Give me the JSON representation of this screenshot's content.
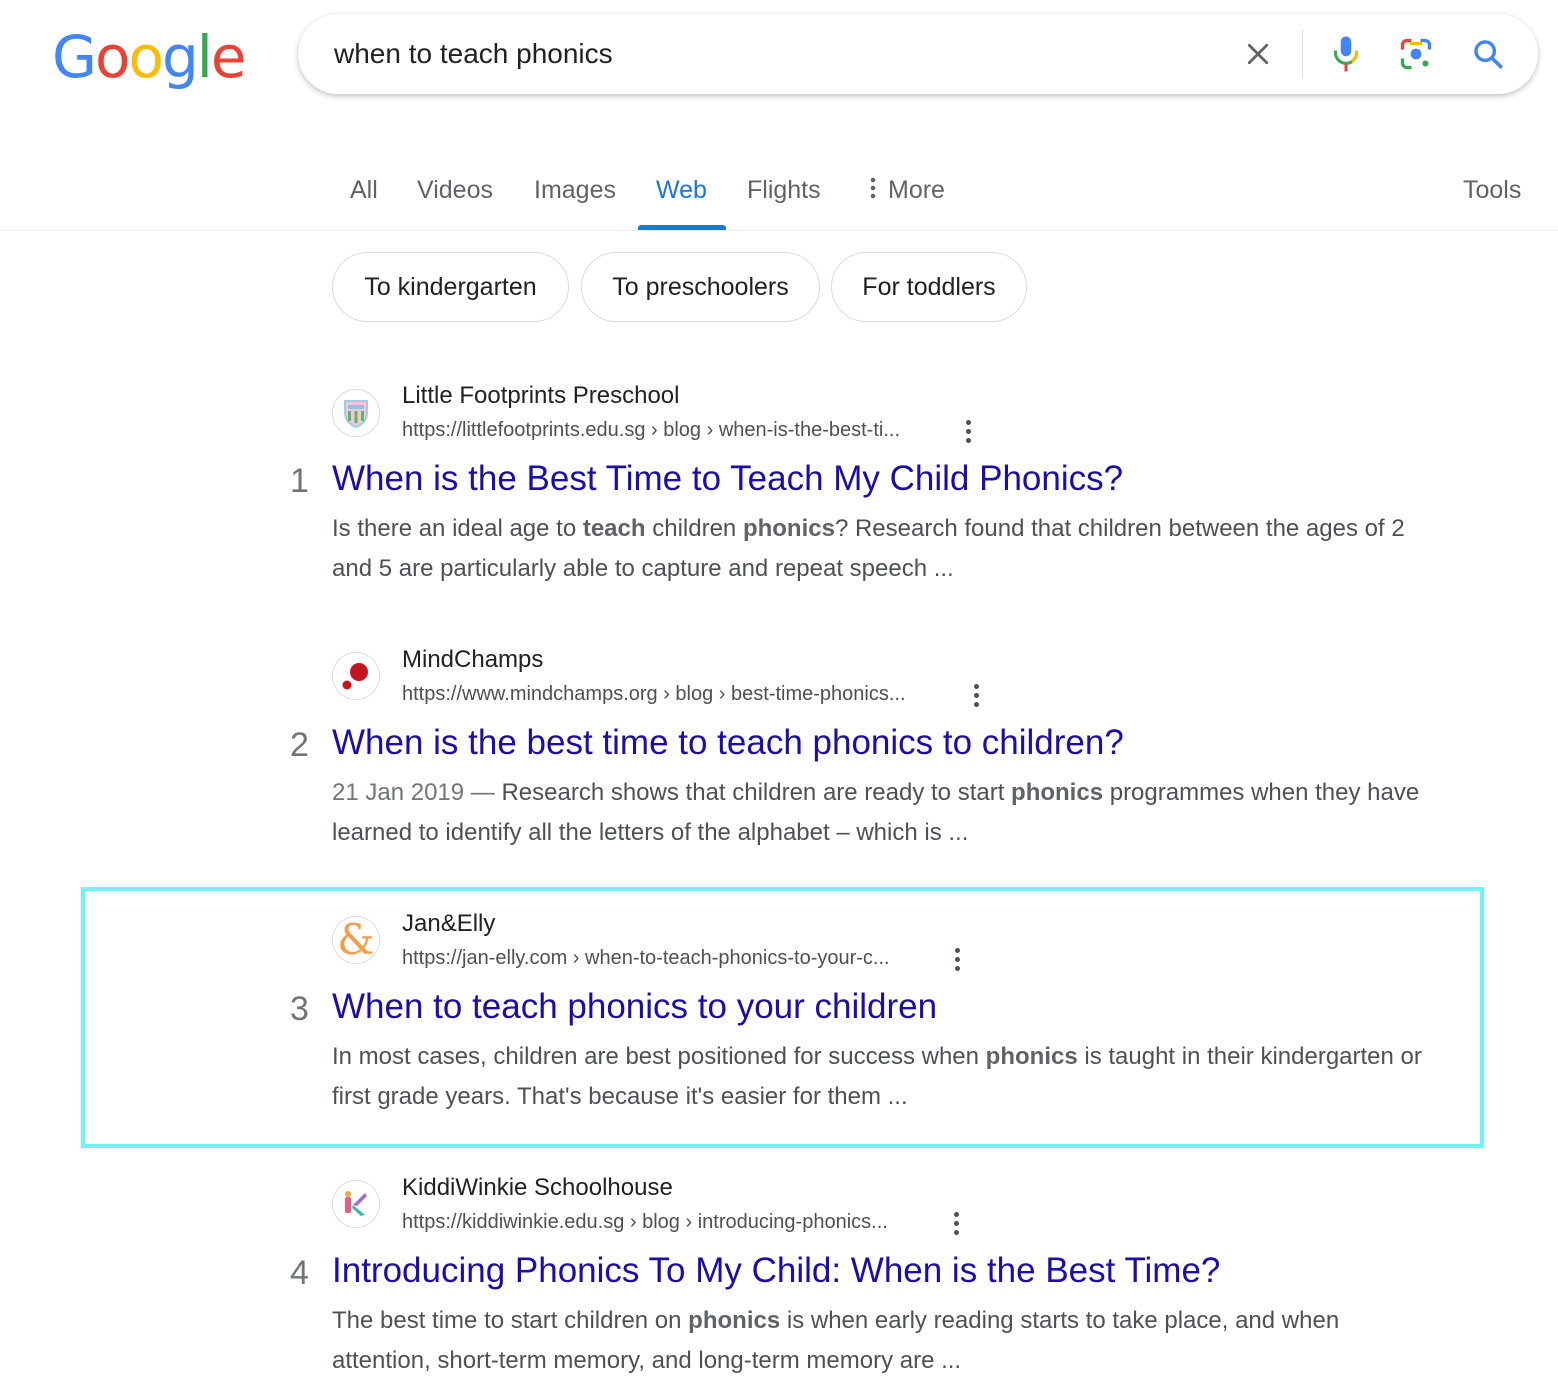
{
  "logo": {
    "letters": [
      "G",
      "o",
      "o",
      "g",
      "l",
      "e"
    ],
    "colors": [
      "#4285f4",
      "#ea4335",
      "#fbbc05",
      "#4285f4",
      "#34a853",
      "#ea4335"
    ]
  },
  "search": {
    "query": "when to teach phonics",
    "icons": [
      "close-icon",
      "mic-icon",
      "lens-icon",
      "search-icon"
    ]
  },
  "tabs": [
    {
      "label": "All",
      "active": false
    },
    {
      "label": "Videos",
      "active": false
    },
    {
      "label": "Images",
      "active": false
    },
    {
      "label": "Web",
      "active": true
    },
    {
      "label": "Flights",
      "active": false
    },
    {
      "label": "More",
      "active": false
    }
  ],
  "tools_label": "Tools",
  "more_icon": "vertical-dots-icon",
  "chips": [
    "To kindergarten",
    "To preschoolers",
    "For toddlers"
  ],
  "colors": {
    "link": "#1a0dab",
    "accent": "#1a73e8",
    "highlight": "#6cf4f8"
  },
  "results": [
    {
      "rank": "1",
      "site": "Little Footprints Preschool",
      "url": "https://littlefootprints.edu.sg › blog › when-is-the-best-ti...",
      "title": "When is the Best Time to Teach My Child Phonics?",
      "snippet": [
        {
          "t": "Is there an ideal age to ",
          "b": false
        },
        {
          "t": "teach",
          "b": true
        },
        {
          "t": " children ",
          "b": false
        },
        {
          "t": "phonics",
          "b": true
        },
        {
          "t": "? Research found that children between the ages of 2 and 5 are particularly able to capture and repeat speech ...",
          "b": false
        }
      ]
    },
    {
      "rank": "2",
      "site": "MindChamps",
      "url": "https://www.mindchamps.org › blog › best-time-phonics...",
      "title": "When is the best time to teach phonics to children?",
      "date": "21 Jan 2019 — ",
      "snippet": [
        {
          "t": "Research shows that children are ready to start ",
          "b": false
        },
        {
          "t": "phonics",
          "b": true
        },
        {
          "t": " programmes when they have learned to identify all the letters of the alphabet – which is ...",
          "b": false
        }
      ]
    },
    {
      "rank": "3",
      "site": "Jan&Elly",
      "url": "https://jan-elly.com › when-to-teach-phonics-to-your-c...",
      "title": "When to teach phonics to your children",
      "snippet": [
        {
          "t": "In most cases, children are best positioned for success when ",
          "b": false
        },
        {
          "t": "phonics",
          "b": true
        },
        {
          "t": " is taught in their kindergarten or first grade years. That's because it's easier for them ...",
          "b": false
        }
      ]
    },
    {
      "rank": "4",
      "site": "KiddiWinkie Schoolhouse",
      "url": "https://kiddiwinkie.edu.sg › blog › introducing-phonics...",
      "title": "Introducing Phonics To My Child: When is the Best Time?",
      "snippet": [
        {
          "t": "The best time to start children on ",
          "b": false
        },
        {
          "t": "phonics",
          "b": true
        },
        {
          "t": " is when early reading starts to take place, and when attention, short-term memory, and long-term memory are ...",
          "b": false
        }
      ]
    }
  ]
}
